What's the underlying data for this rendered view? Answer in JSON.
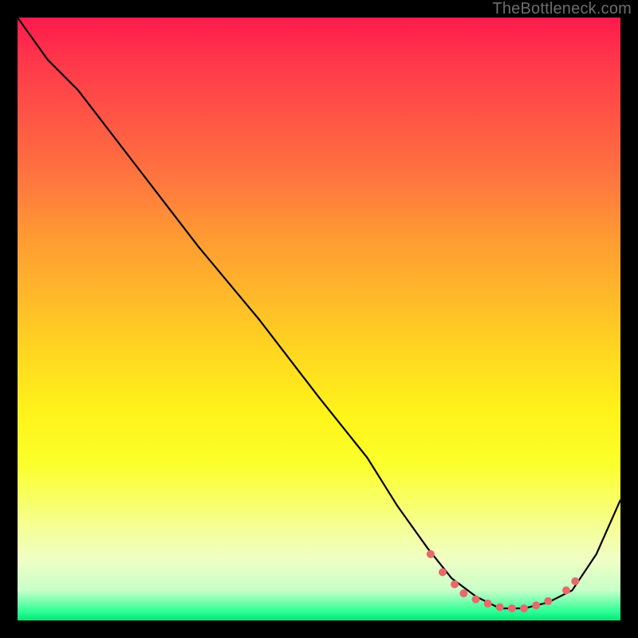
{
  "watermark": "TheBottleneck.com",
  "chart_data": {
    "type": "line",
    "title": "",
    "xlabel": "",
    "ylabel": "",
    "xlim": [
      0,
      100
    ],
    "ylim": [
      0,
      100
    ],
    "grid": false,
    "legend": false,
    "line": {
      "x": [
        0,
        5,
        10,
        20,
        30,
        40,
        50,
        58,
        63,
        68,
        72,
        76,
        80,
        84,
        88,
        92,
        96,
        100
      ],
      "y": [
        100,
        93,
        88,
        75,
        62,
        50,
        37,
        27,
        19,
        12,
        7,
        4,
        2,
        2,
        3,
        5,
        11,
        20
      ],
      "color": "#000000"
    },
    "dots": {
      "x": [
        68.5,
        70.5,
        72.5,
        74.0,
        76.0,
        78.0,
        80.0,
        82.0,
        84.0,
        86.0,
        88.0,
        91.0,
        92.5
      ],
      "y": [
        11.0,
        8.0,
        6.0,
        4.5,
        3.5,
        2.8,
        2.2,
        2.0,
        2.0,
        2.5,
        3.2,
        5.0,
        6.5
      ],
      "color": "#e76a6a",
      "radius_px": 5
    }
  }
}
